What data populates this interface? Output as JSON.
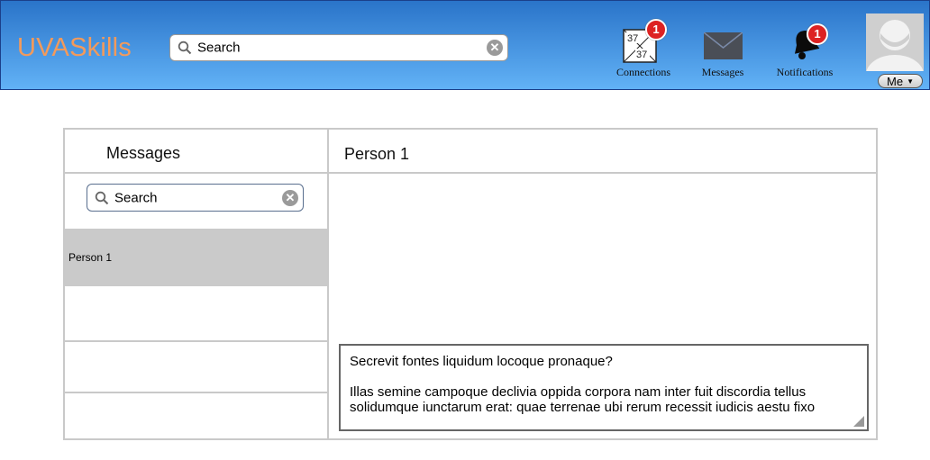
{
  "header": {
    "logo": "UVASkills",
    "search_placeholder": "Search",
    "nav": {
      "connections_label": "Connections",
      "connections_badge": "1",
      "messages_label": "Messages",
      "notifications_label": "Notifications",
      "notifications_badge": "1"
    },
    "me_label": "Me",
    "colors": {
      "logo": "#f39a5b",
      "header_top": "#2a74c9",
      "header_bottom": "#62b2f6",
      "badge": "#d22222"
    }
  },
  "sidebar": {
    "title": "Messages",
    "search_placeholder": "Search",
    "conversations": [
      "Person 1",
      "",
      "",
      ""
    ]
  },
  "conversation": {
    "title": "Person 1",
    "message_line1": "Secrevit fontes liquidum locoque pronaque?",
    "message_line2": "Illas semine campoque declivia oppida corpora nam inter fuit discordia tellus solidumque iunctarum erat: quae terrenae ubi rerum recessit iudicis aestu fixo"
  }
}
